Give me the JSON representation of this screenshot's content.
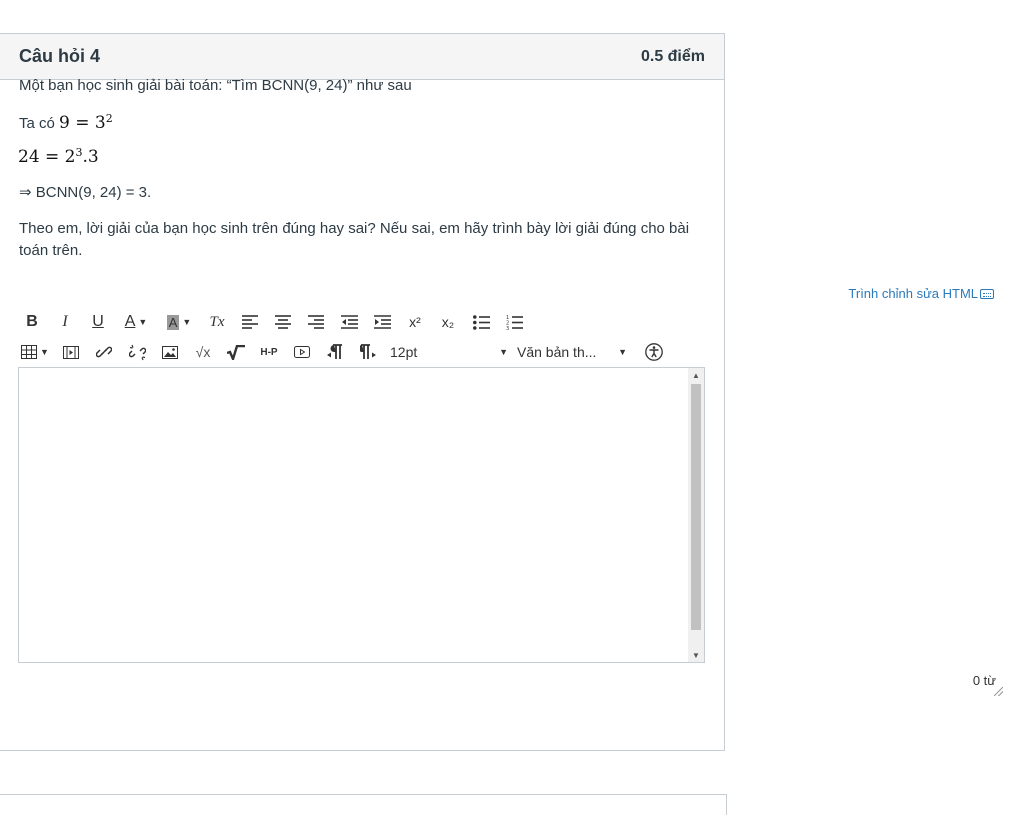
{
  "question": {
    "title": "Câu hỏi 4",
    "points": "0.5 điểm",
    "line1": "Một bạn học sinh giải bài toán: “Tìm BCNN(9, 24)” như sau",
    "line2_prefix": "Ta có",
    "eq1_lhs": "9 = 3",
    "eq1_exp": "2",
    "eq2_base": "24 = 2",
    "eq2_exp": "3",
    "eq2_tail": ".3",
    "line4": "⇒ BCNN(9, 24) = 3.",
    "line5": "Theo em, lời giải của bạn học sinh trên đúng hay sai? Nếu sai, em hãy trình bày lời giải đúng cho bài toán trên."
  },
  "editor": {
    "html_editor_link": "Trình chỉnh sửa HTML",
    "font_size": "12pt",
    "block_format": "Văn bản th...",
    "word_count": "0 từ"
  },
  "icons": {
    "keyboard": "keyboard-icon",
    "bold": "B",
    "italic": "I",
    "underline": "U",
    "text_color": "A",
    "background_color": "A",
    "clear_format": "Tx",
    "superscript": "x²",
    "subscript": "x₂"
  },
  "colors": {
    "link": "#2b7abc",
    "header_bg": "#f5f5f5",
    "border": "#c7cdd1"
  }
}
